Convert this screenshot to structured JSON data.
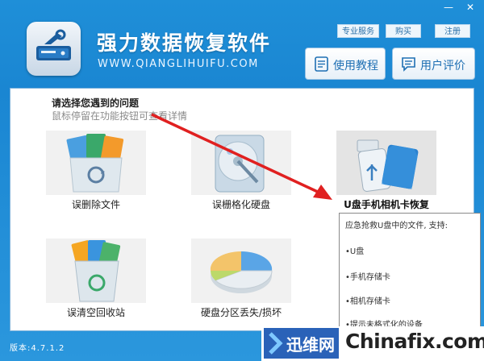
{
  "window": {
    "title": "强力数据恢复软件",
    "url": "WWW.QIANGLIHUIFU.COM",
    "minimize": "—",
    "close": "✕"
  },
  "top_links": {
    "service": "专业服务",
    "buy": "购买",
    "register": "注册"
  },
  "buttons": {
    "tutorial": "使用教程",
    "review": "用户评价"
  },
  "prompt": {
    "title": "请选择您遇到的问题",
    "hint": "鼠标停留在功能按钮可查看详情"
  },
  "tiles": [
    {
      "label": "误删除文件",
      "icon": "recycle-files-icon"
    },
    {
      "label": "误栅格化硬盘",
      "icon": "hard-disk-icon"
    },
    {
      "label": "U盘手机相机卡恢复",
      "icon": "usb-sd-card-icon"
    },
    {
      "label": "误清空回收站",
      "icon": "recycle-bin-icon"
    },
    {
      "label": "硬盘分区丢失/损坏",
      "icon": "pie-partition-icon"
    }
  ],
  "tooltip": {
    "title": "应急抢救U盘中的文件, 支持:",
    "items": [
      "•U盘",
      "•手机存储卡",
      "•相机存储卡",
      "•提示未格式化的设备"
    ]
  },
  "version": "版本:4.7.1.2",
  "watermark": {
    "left": "迅维网",
    "right": "Chinafix.com"
  },
  "colors": {
    "header_blue": "#1a86d2",
    "arrow_red": "#e02020",
    "accent": "#1e6fb3"
  }
}
